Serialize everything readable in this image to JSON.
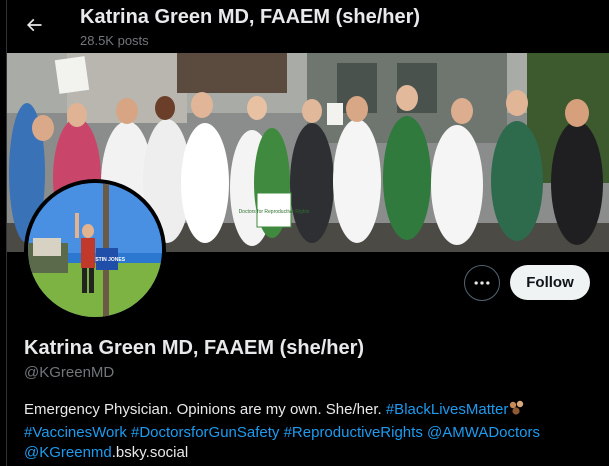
{
  "header": {
    "title": "Katrina Green MD, FAAEM (she/her)",
    "post_count": "28.5K posts"
  },
  "profile": {
    "display_name": "Katrina Green MD, FAAEM (she/her)",
    "handle": "@KGreenMD",
    "follow_label": "Follow",
    "bio": {
      "line1_text": "Emergency Physician. Opinions are my own. She/her.",
      "hashtag_blm": "#BlackLivesMatter",
      "hashtag_vaccines": "#VaccinesWork",
      "hashtag_gunsafety": "#DoctorsforGunSafety",
      "hashtag_repro": "#ReproductiveRights",
      "mention_amwa": "@AMWADoctors",
      "mention_bsky": "@KGreenmd",
      "bsky_suffix": ".bsky.social"
    },
    "avatar_sign_text": "JUSTIN JONES"
  },
  "banner_sign_text": "Doctors for Reproductive Rights",
  "colors": {
    "link": "#1d9bf0",
    "background": "#000000",
    "primary_text": "#e7e9ea",
    "secondary_text": "#71767b",
    "follow_bg": "#eff3f4"
  },
  "icons": {
    "back": "arrow-left-icon",
    "more": "more-horizontal-icon",
    "emoji": "raised-fist-emoji-icon"
  }
}
